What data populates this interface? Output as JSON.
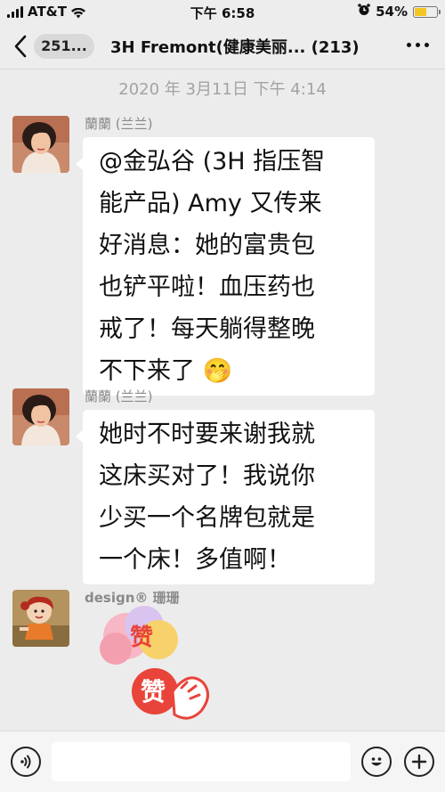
{
  "status_bar": {
    "carrier": "AT&T",
    "time": "下午 6:58",
    "battery": "54%",
    "battery_level": 0.54
  },
  "nav": {
    "unread_count": "251...",
    "title": "3H  Fremont(健康美丽... (213)"
  },
  "chat": {
    "timestamp": "2020 年 3月11日  下午 4:14",
    "messages": [
      {
        "sender": "蘭蘭 (兰兰)",
        "lines": [
          "@金弘谷 (3H 指压智",
          "能产品) Amy 又传来",
          "好消息：她的富贵包",
          "也铲平啦！血压药也",
          "戒了！每天躺得整晚",
          "不下来了"
        ],
        "emoji": "🤭"
      },
      {
        "sender": "蘭蘭 (兰兰)",
        "lines": [
          "她时不时要来谢我就",
          "这床买对了！我说你",
          "少买一个名牌包就是",
          "一个床！多值啊！"
        ]
      },
      {
        "sender": "design® 珊珊",
        "sticker_text": [
          "赞",
          "赞"
        ]
      }
    ]
  },
  "input_bar": {
    "placeholder": ""
  }
}
